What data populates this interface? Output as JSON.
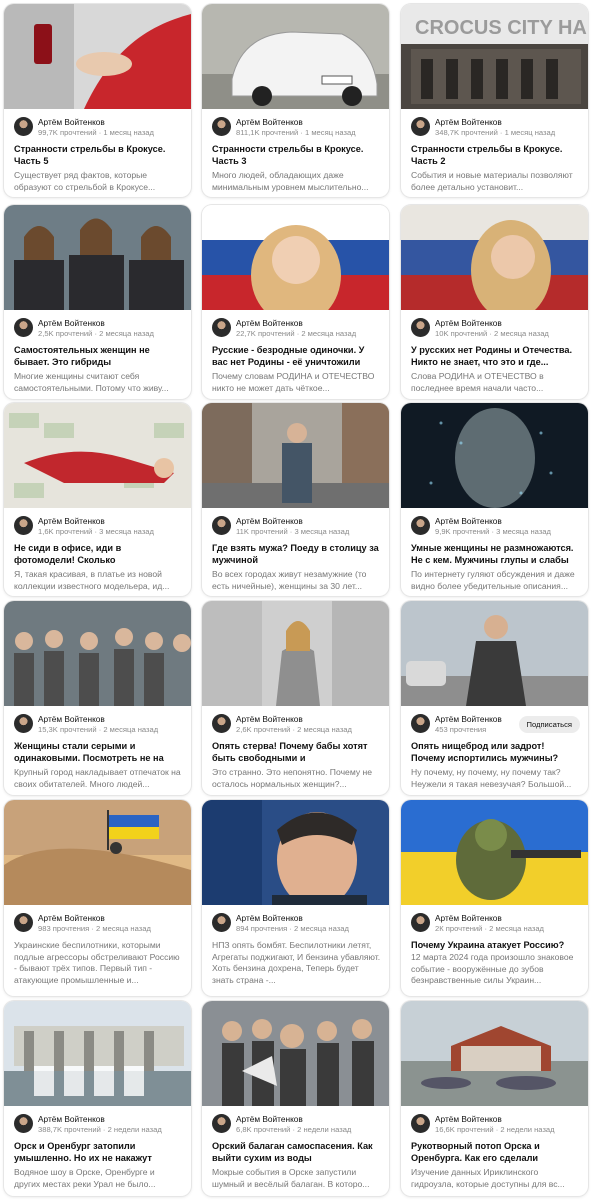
{
  "author": "Артём Войтенков",
  "subscribe_label": "Подписаться",
  "cards": [
    {
      "stats": "99,7K прочтений · 1 месяц назад",
      "title": "Странности стрельбы в Крокусе. Часть 5",
      "snippet": "Существует ряд фактов, которые образуют со стрельбой в Крокусе..."
    },
    {
      "stats": "811,1K прочтений · 1 месяц назад",
      "title": "Странности стрельбы в Крокусе. Часть 3",
      "snippet": "Много людей, обладающих даже минимальным уровнем мыслительно..."
    },
    {
      "stats": "348,7K прочтений · 1 месяц назад",
      "title": "Странности стрельбы в Крокусе. Часть 2",
      "snippet": "События и новые материалы позволяют более детально установит..."
    },
    {
      "stats": "2,5K прочтений · 2 месяца назад",
      "title": "Самостоятельных женщин не бывает. Это гибриды",
      "snippet": "Многие женщины считают себя самостоятельными. Потому что живу..."
    },
    {
      "stats": "22,7K прочтений · 2 месяца назад",
      "title": "Русские - безродные одиночки. У вас нет Родины - её уничтожили",
      "snippet": "Почему словам РОДИНА и ОТЕЧЕСТВО никто не может дать чёткое..."
    },
    {
      "stats": "10K прочтений · 2 месяца назад",
      "title": "У русских нет Родины и Отечества. Никто не знает, что это и где...",
      "snippet": "Слова РОДИНА и ОТЕЧЕСТВО в последнее время начали часто..."
    },
    {
      "stats": "1,6K прочтений · 3 месяца назад",
      "title": "Не сиди в офисе, иди в фотомодели! Сколько зарабатывают девочки на...",
      "snippet": "Я, такая красивая, в платье из новой коллекции известного модельера, ид..."
    },
    {
      "stats": "11K прочтений · 3 месяца назад",
      "title": "Где взять мужа? Поеду в столицу за мужчиной",
      "snippet": "Во всех городах живут незамужние (то есть ничейные), женщины за 30 лет..."
    },
    {
      "stats": "9,9K прочтений · 3 месяца назад",
      "title": "Умные женщины не размножаются. Не с кем. Мужчины глупы и слабы",
      "snippet": "По интернету гуляют обсуждения и даже видно более убедительные описания..."
    },
    {
      "stats": "15,3K прочтений · 2 месяца назад",
      "title": "Женщины стали серыми и одинаковыми. Посмотреть не на кого",
      "snippet": "Крупный город накладывает отпечаток на своих обитателей. Много людей..."
    },
    {
      "stats": "2,6K прочтений · 2 месяца назад",
      "title": "Опять стерва! Почему бабы хотят быть свободными и независимыми?",
      "snippet": "Это странно. Это непонятно. Почему не осталось нормальных женщин?..."
    },
    {
      "stats": "453 прочтения",
      "title": "Опять нищеброд или задрот! Почему испортились мужчины?",
      "snippet": "Ну почему, ну почему, ну почему так? Неужели я такая невезучая? Большой..."
    },
    {
      "stats": "983 прочтения · 2 месяца назад",
      "title": "",
      "snippet": "Украинские беспилотники, которыми подлые агрессоры обстреливают Россию - бывают трёх типов. Первый тип - атакующие промышленные и..."
    },
    {
      "stats": "894 прочтения · 2 месяца назад",
      "title": "",
      "snippet": "НПЗ опять бомбят. Беспилотники летят, Агрегаты поджигают, И бензина убавляют. Хоть бензина дохрена, Теперь будет знать страна -..."
    },
    {
      "stats": "2К прочтений · 2 месяца назад",
      "title": "Почему Украина атакует Россию?",
      "snippet": "12 марта 2024 года произошло знаковое событие - вооружённые до зубов безнравственные силы Украин..."
    },
    {
      "stats": "388,7K прочтений · 2 недели назад",
      "title": "Орск и Оренбург затопили умышленно. Но их не накажут",
      "snippet": "Водяное шоу в Орске, Оренбурге и других местах реки Урал не было..."
    },
    {
      "stats": "6,8K прочтений · 2 недели назад",
      "title": "Орский балаган самоспасения. Как выйти сухим из воды",
      "snippet": "Мокрые события в Орске запустили шумный и весёлый балаган. В которо..."
    },
    {
      "stats": "16,6K прочтений · 2 недели назад",
      "title": "Рукотворный потоп Орска и Оренбурга. Как его сделали",
      "snippet": "Изучение данных Ириклинского гидроузла, которые доступны для вс..."
    }
  ],
  "thumbnails": [
    {
      "icon": "blood-donation-photo"
    },
    {
      "icon": "white-car-photo"
    },
    {
      "icon": "crocus-city-hall-burned-photo",
      "sign": "CROCUS CITY HALL"
    },
    {
      "icon": "three-women-photo"
    },
    {
      "icon": "girl-russian-flag-photo"
    },
    {
      "icon": "woman-russian-flag-photo"
    },
    {
      "icon": "model-on-money-photo"
    },
    {
      "icon": "man-in-street-photo"
    },
    {
      "icon": "digital-face-photo"
    },
    {
      "icon": "crowd-of-women-photo"
    },
    {
      "icon": "woman-in-coat-photo"
    },
    {
      "icon": "man-in-city-photo"
    },
    {
      "icon": "drone-ukrainian-flag-photo"
    },
    {
      "icon": "zelensky-photo"
    },
    {
      "icon": "soldier-illustration"
    },
    {
      "icon": "dam-spillway-photo"
    },
    {
      "icon": "crowd-megaphone-photo"
    },
    {
      "icon": "flooded-house-photo"
    }
  ]
}
